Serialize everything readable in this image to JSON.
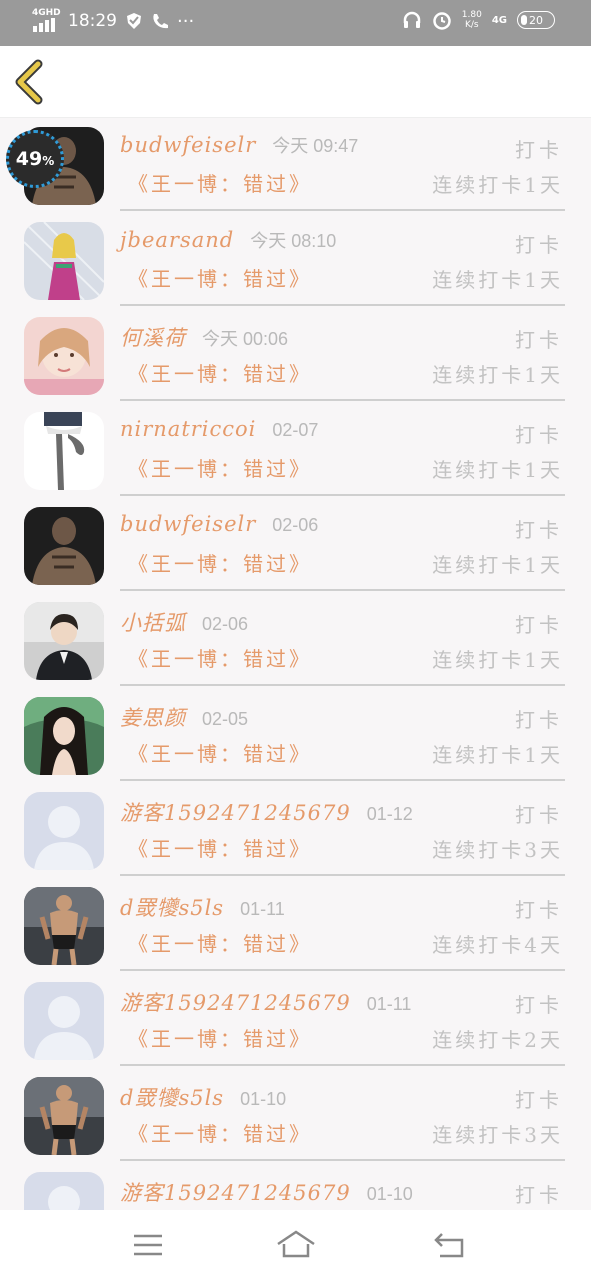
{
  "status_bar": {
    "network": "4GHD",
    "time": "18:29",
    "more": "···",
    "speed": "1.80",
    "speed_unit": "K/s",
    "network_right": "4G",
    "battery": "20"
  },
  "floating_progress": {
    "value": "49",
    "unit": "%"
  },
  "rows": [
    {
      "name": "budwfeiselr",
      "time": "今天 09:47",
      "book": "《王一博：错过》",
      "checkin": "打卡",
      "streak": "连续打卡1天",
      "avatar": "muscular-man"
    },
    {
      "name": "jbearsand",
      "time": "今天 08:10",
      "book": "《王一博：错过》",
      "checkin": "打卡",
      "streak": "连续打卡1天",
      "avatar": "girl-in-rain"
    },
    {
      "name": "何溪荷",
      "time": "今天 00:06",
      "book": "《王一博：错过》",
      "checkin": "打卡",
      "streak": "连续打卡1天",
      "avatar": "girl-pink"
    },
    {
      "name": "nirnatriccoi",
      "time": "02-07",
      "book": "《王一博：错过》",
      "checkin": "打卡",
      "streak": "连续打卡1天",
      "avatar": "legs"
    },
    {
      "name": "budwfeiselr",
      "time": "02-06",
      "book": "《王一博：错过》",
      "checkin": "打卡",
      "streak": "连续打卡1天",
      "avatar": "muscular-man"
    },
    {
      "name": "小括弧",
      "time": "02-06",
      "book": "《王一博：错过》",
      "checkin": "打卡",
      "streak": "连续打卡1天",
      "avatar": "young-man"
    },
    {
      "name": "姜思颜",
      "time": "02-05",
      "book": "《王一博：错过》",
      "checkin": "打卡",
      "streak": "连续打卡1天",
      "avatar": "long-hair-girl"
    },
    {
      "name": "游客1592471245679",
      "time": "01-12",
      "book": "《王一博：错过》",
      "checkin": "打卡",
      "streak": "连续打卡3天",
      "avatar": "default"
    },
    {
      "name": "d罭犪s5ls",
      "time": "01-11",
      "book": "《王一博：错过》",
      "checkin": "打卡",
      "streak": "连续打卡4天",
      "avatar": "fitness-man"
    },
    {
      "name": "游客1592471245679",
      "time": "01-11",
      "book": "《王一博：错过》",
      "checkin": "打卡",
      "streak": "连续打卡2天",
      "avatar": "default"
    },
    {
      "name": "d罭犪s5ls",
      "time": "01-10",
      "book": "《王一博：错过》",
      "checkin": "打卡",
      "streak": "连续打卡3天",
      "avatar": "fitness-man"
    },
    {
      "name": "游客1592471245679",
      "time": "01-10",
      "book": "",
      "checkin": "打卡",
      "streak": "",
      "avatar": "default"
    }
  ],
  "colors": {
    "accent": "#e59a6a",
    "muted": "#c2c2c2",
    "back": "#e6c84a"
  }
}
